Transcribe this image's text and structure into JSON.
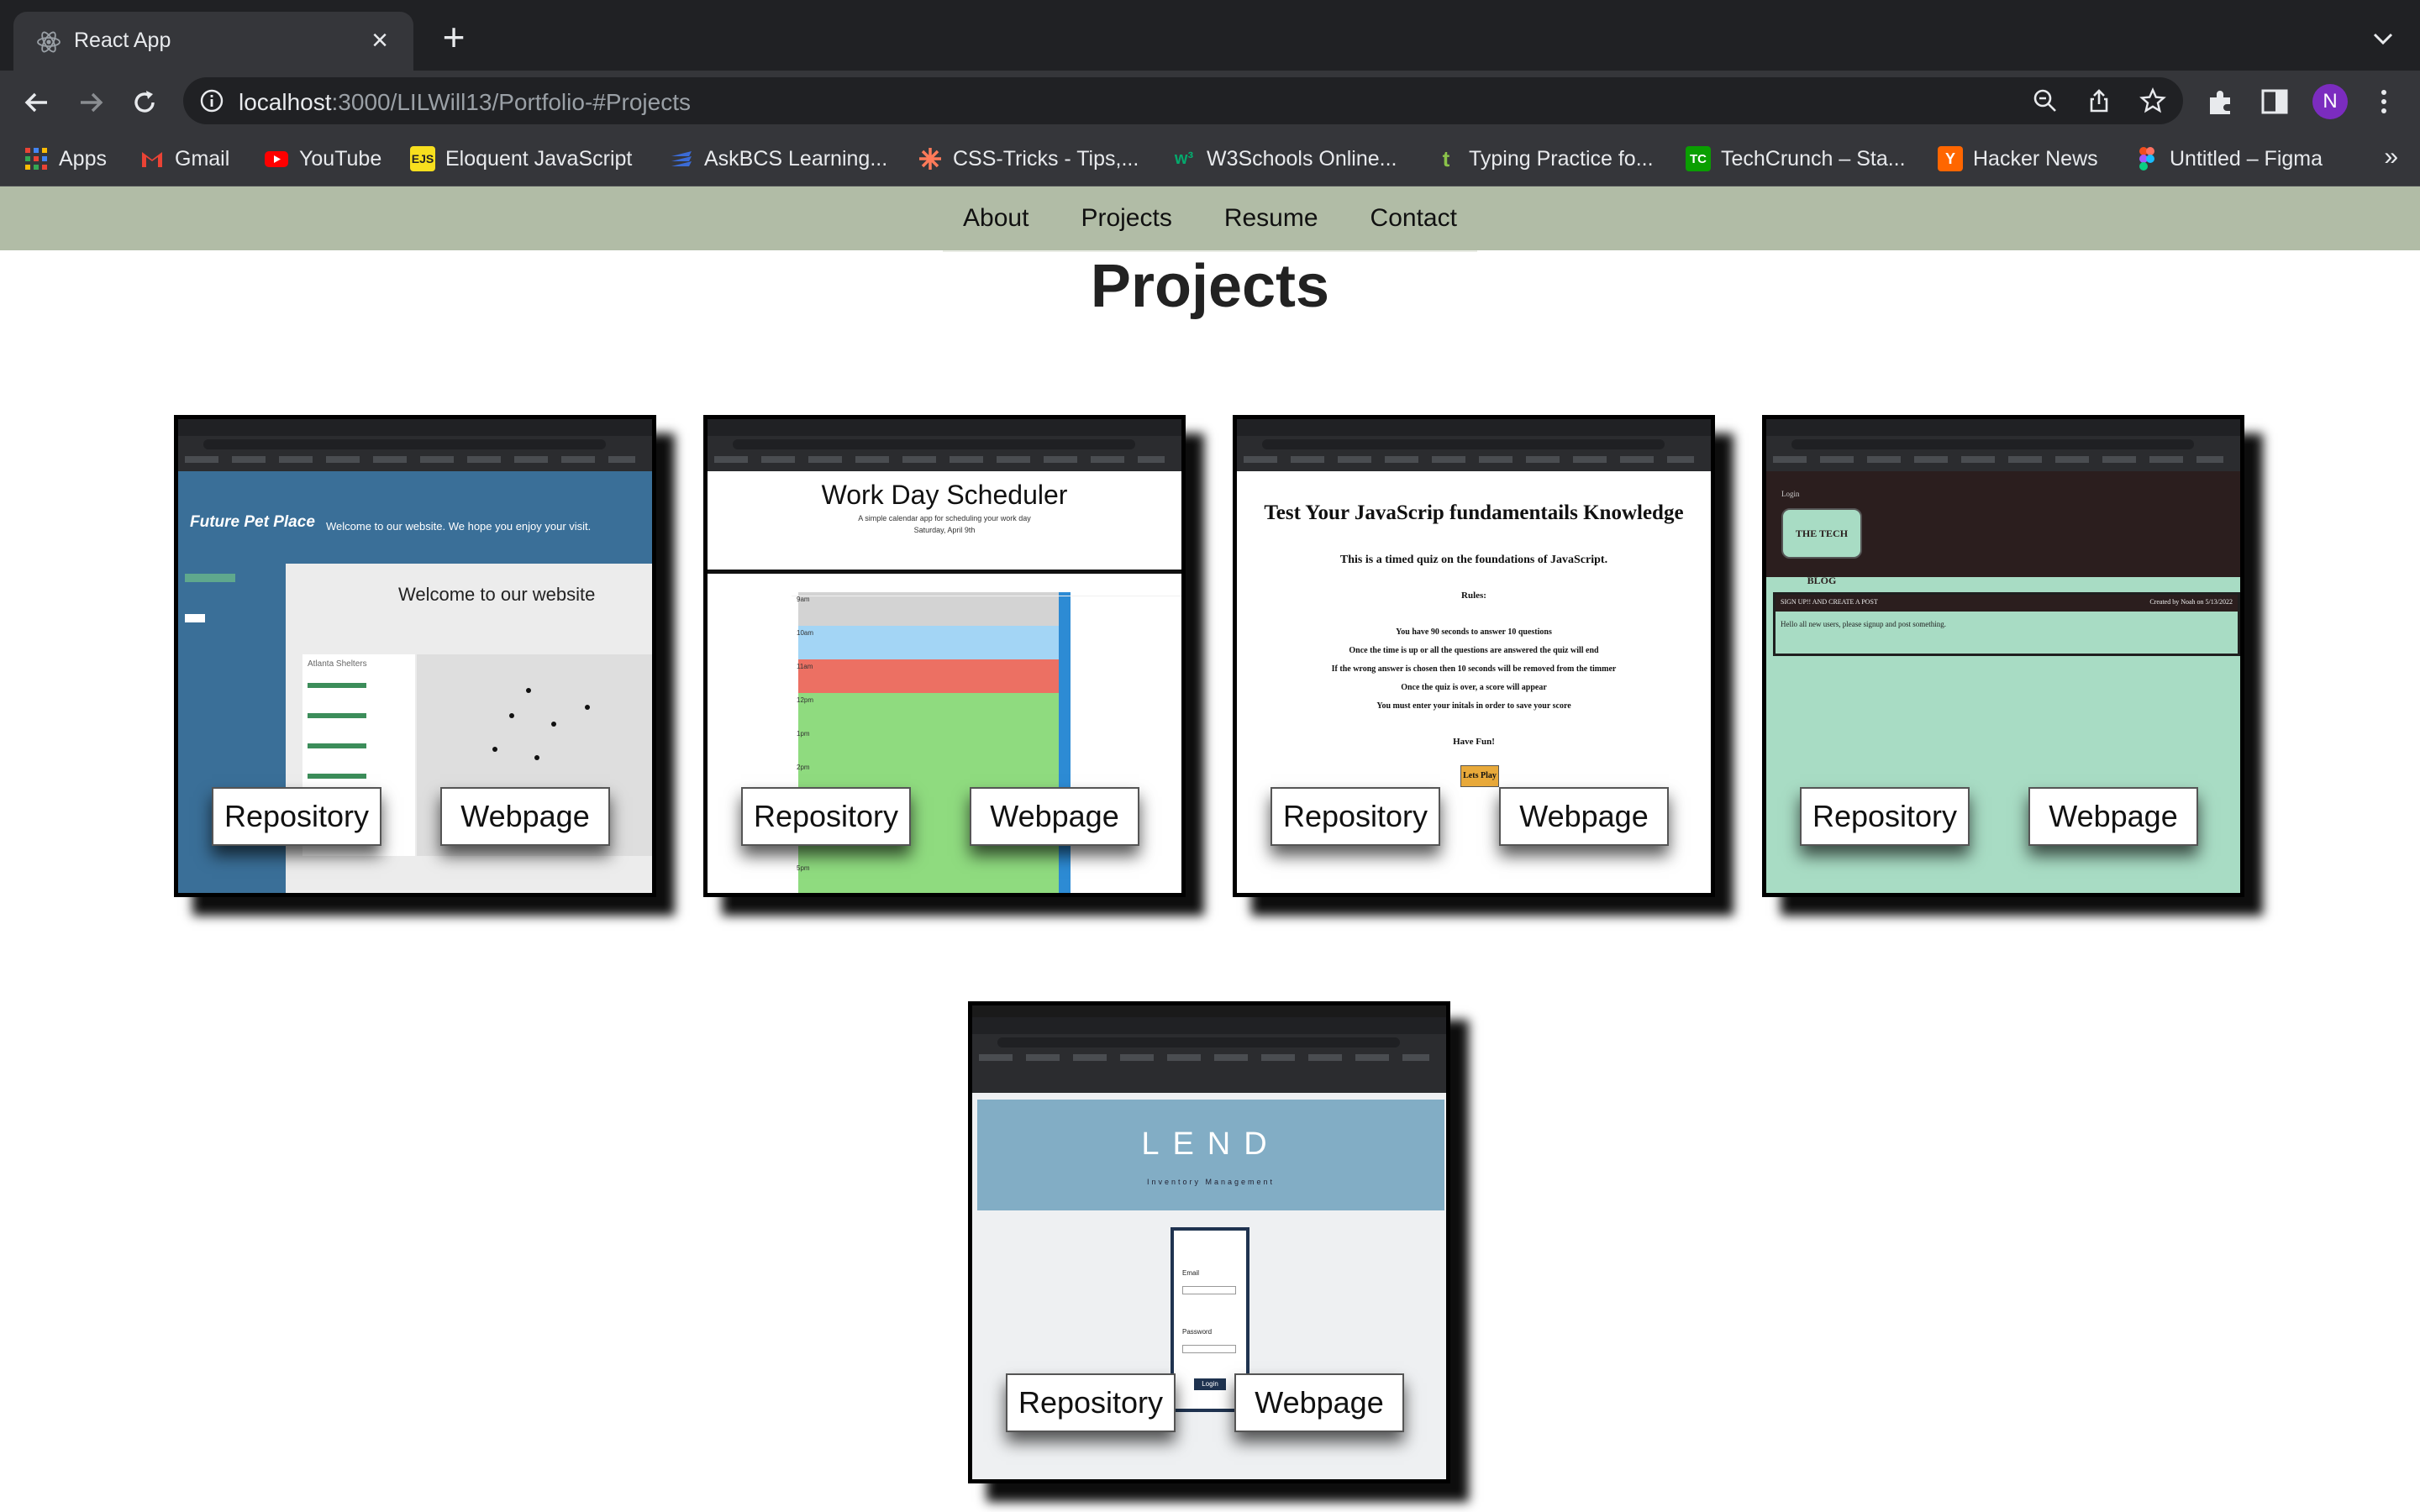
{
  "browser": {
    "tab_title": "React App",
    "url_host": "localhost",
    "url_rest": ":3000/LILWill13/Portfolio-#Projects",
    "avatar_letter": "N"
  },
  "bookmarks": [
    {
      "label": "Apps",
      "icon": "apps-grid-icon",
      "color": "#ea4335"
    },
    {
      "label": "Gmail",
      "icon": "gmail-icon",
      "color": "#ea4335"
    },
    {
      "label": "YouTube",
      "icon": "youtube-icon",
      "color": "#ff0000"
    },
    {
      "label": "Eloquent JavaScript",
      "icon": "ejs-icon",
      "color": "#f7df1e"
    },
    {
      "label": "AskBCS Learning...",
      "icon": "askbcs-icon",
      "color": "#3b6bd6"
    },
    {
      "label": "CSS-Tricks - Tips,...",
      "icon": "css-tricks-icon",
      "color": "#ff7a59"
    },
    {
      "label": "W3Schools Online...",
      "icon": "w3schools-icon",
      "color": "#04aa6d"
    },
    {
      "label": "Typing Practice fo...",
      "icon": "typing-icon",
      "color": "#8bc34a"
    },
    {
      "label": "TechCrunch – Sta...",
      "icon": "techcrunch-icon",
      "color": "#0a9e01"
    },
    {
      "label": "Hacker News",
      "icon": "hacker-news-icon",
      "color": "#ff6600"
    },
    {
      "label": "Untitled – Figma",
      "icon": "figma-icon",
      "color": "#a259ff"
    }
  ],
  "nav": [
    "About",
    "Projects",
    "Resume",
    "Contact"
  ],
  "page_title": "Projects",
  "projects": [
    {
      "name": "future-pet-place",
      "repo_label": "Repository",
      "web_label": "Webpage",
      "preview": {
        "brand": "Future Pet Place",
        "tagline": "Welcome to our website. We hope you enjoy your visit.",
        "heading": "Welcome to our website",
        "list_title": "Atlanta Shelters"
      }
    },
    {
      "name": "work-day-scheduler",
      "repo_label": "Repository",
      "web_label": "Webpage",
      "preview": {
        "heading": "Work Day Scheduler",
        "sub": "A simple calendar app for scheduling your work day",
        "date": "Saturday, April 9th",
        "hours": [
          "9am",
          "10am",
          "11am",
          "12pm",
          "1pm",
          "2pm",
          "3pm",
          "4pm",
          "5pm"
        ]
      }
    },
    {
      "name": "javascript-quiz",
      "repo_label": "Repository",
      "web_label": "Webpage",
      "preview": {
        "heading": "Test Your JavaScrip fundamentails Knowledge",
        "sub": "This is a timed quiz on the foundations of JavaScript.",
        "rules_title": "Rules:",
        "rules": [
          "You have 90 seconds to answer 10 questions",
          "Once the time is up or all the questions are answered the quiz will end",
          "If the wrong answer is chosen then 10 seconds will be removed from the timmer",
          "Once the quiz is over, a score will appear",
          "You must enter your initals in order to save your score"
        ],
        "outro": "Have Fun!",
        "button": "Lets Play"
      }
    },
    {
      "name": "tech-blog",
      "repo_label": "Repository",
      "web_label": "Webpage",
      "preview": {
        "login": "Login",
        "brand": "THE TECH BLOG",
        "post_title": "SIGN UP!! AND CREATE A POST",
        "post_meta": "Created by Noah on 5/13/2022",
        "post_body": "Hello all new users, please signup and post something."
      }
    },
    {
      "name": "lend",
      "repo_label": "Repository",
      "web_label": "Webpage",
      "preview": {
        "brand": "LEND",
        "sub": "Inventory Management",
        "email_label": "Email",
        "password_label": "Password",
        "button": "Login"
      }
    }
  ]
}
